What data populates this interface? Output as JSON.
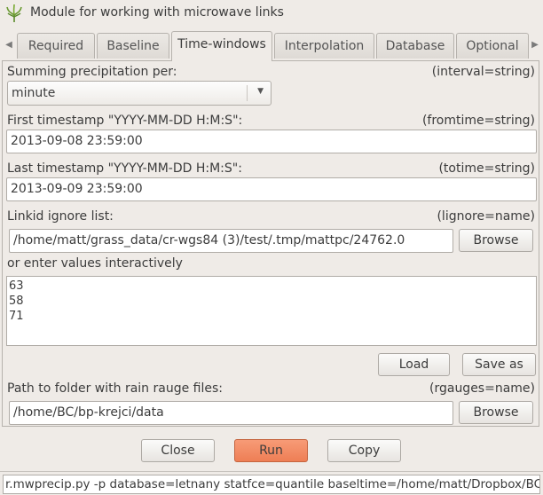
{
  "window": {
    "title": "Module for working with microwave links"
  },
  "tabs": [
    {
      "label": "Required"
    },
    {
      "label": "Baseline"
    },
    {
      "label": "Time-windows"
    },
    {
      "label": "Interpolation"
    },
    {
      "label": "Database"
    },
    {
      "label": "Optional"
    }
  ],
  "active_tab": "Time-windows",
  "fields": {
    "interval": {
      "label": "Summing precipitation per:",
      "hint": "(interval=string)",
      "value": "minute"
    },
    "fromtime": {
      "label": "First timestamp \"YYYY-MM-DD H:M:S\":",
      "hint": "(fromtime=string)",
      "value": "2013-09-08 23:59:00"
    },
    "totime": {
      "label": "Last timestamp \"YYYY-MM-DD H:M:S\":",
      "hint": "(totime=string)",
      "value": "2013-09-09 23:59:00"
    },
    "lignore": {
      "label": "Linkid ignore list:",
      "hint": "(lignore=name)",
      "value": "/home/matt/grass_data/cr-wgs84 (3)/test/.tmp/mattpc/24762.0",
      "browse_label": "Browse",
      "interactive_label": "or enter values interactively",
      "interactive_lines": [
        "63",
        "58",
        "71"
      ],
      "load_label": "Load",
      "save_as_label": "Save as"
    },
    "rgauges": {
      "label": "Path to folder with rain rauge files:",
      "hint": "(rgauges=name)",
      "value": "/home/BC/bp-krejci/data",
      "browse_label": "Browse"
    }
  },
  "buttons": {
    "close": "Close",
    "run": "Run",
    "copy": "Copy"
  },
  "status": {
    "command": "r.mwprecip.py -p database=letnany statfce=quantile baseltime=/home/matt/Dropbox/BC/"
  },
  "colors": {
    "run_button": "#f08660",
    "background": "#efebe7"
  }
}
